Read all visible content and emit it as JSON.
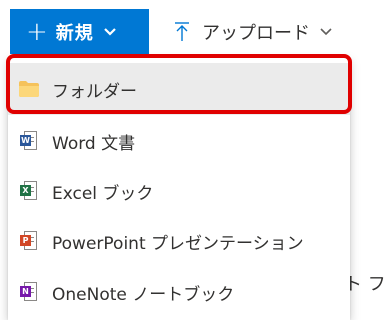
{
  "toolbar": {
    "new_label": "新規",
    "upload_label": "アップロード"
  },
  "menu": {
    "items": [
      {
        "label": "フォルダー",
        "icon": "folder-icon"
      },
      {
        "label": "Word 文書",
        "icon": "word-icon"
      },
      {
        "label": "Excel ブック",
        "icon": "excel-icon"
      },
      {
        "label": "PowerPoint プレゼンテーション",
        "icon": "powerpoint-icon"
      },
      {
        "label": "OneNote ノートブック",
        "icon": "onenote-icon"
      }
    ]
  },
  "background_text": "ト フ",
  "colors": {
    "accent": "#0078d4",
    "highlight": "#e00000",
    "word": "#2b579a",
    "excel": "#217346",
    "powerpoint": "#d24726",
    "onenote": "#7719aa",
    "folder": "#f5c25b"
  }
}
